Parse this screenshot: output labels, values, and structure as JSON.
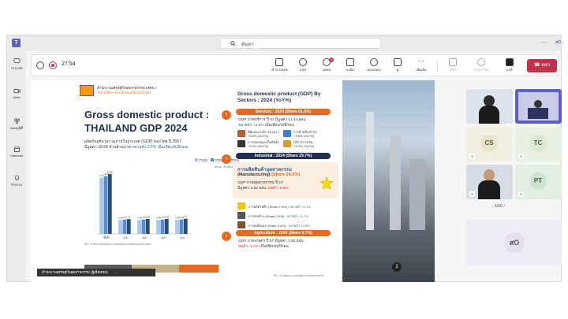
{
  "titlebar": {
    "search_placeholder": "ค้นหา",
    "more": "···",
    "user_initials": "สO"
  },
  "rail": [
    {
      "label": "การแชท",
      "icon": "chat-icon"
    },
    {
      "label": "Meet",
      "icon": "video-icon"
    },
    {
      "label": "คอมมูนิตี้",
      "icon": "community-icon"
    },
    {
      "label": "Calendar",
      "icon": "calendar-icon"
    },
    {
      "label": "กิจกรรม",
      "icon": "bell-icon"
    }
  ],
  "meeting": {
    "timer": "27:54",
    "controls": [
      {
        "label": "เข้าร่วมแชท",
        "icon": "chat-bubble-icon"
      },
      {
        "label": "แชท",
        "icon": "message-icon"
      },
      {
        "label": "บุคคล",
        "icon": "people-icon",
        "badge": "2"
      },
      {
        "label": "ยกมือ",
        "icon": "raise-hand-icon"
      },
      {
        "label": "ตอบสนอง",
        "icon": "reaction-icon"
      },
      {
        "label": "ดู",
        "icon": "view-icon"
      },
      {
        "label": "เพิ่มเติม",
        "icon": "more-icon"
      }
    ],
    "media_controls": [
      {
        "label": "กล้อง",
        "icon": "camera-off-icon"
      },
      {
        "label": "ไมโครโฟน",
        "icon": "mic-off-icon"
      },
      {
        "label": "แชร์",
        "icon": "share-icon"
      }
    ],
    "leave_label": "ออก"
  },
  "slide": {
    "org_th": "สำนักงานเศรษฐกิจอุตสาหกรรม (สศอ.)",
    "org_en": "The Office of Industrial Economics",
    "title_line1": "Gross domestic product :",
    "title_line2": "THAILAND GDP 2024",
    "subtitle_part1": "ผลิตภัณฑ์มวลรวมภายในประเทศ (GDP) ของไทย ปี 2567",
    "subtitle_part2": "มีมูลค่า 18.58 ล้านล้านบาท",
    "subtitle_part3": "ขยายตัว 2.5% เมื่อเทียบกับปีก่อน",
    "sector_title": "Gross domestic product (GDP) By Sectors : 2024 (YoY%)",
    "services_pill": "Services : 2024 (Share 61.6%)",
    "services_line1": "GDP ภาคบริการ ปี 67 มีมูลค่า 11.44 ลลบ.",
    "services_line2_a": "ขยายตัว +3.9%",
    "services_line2_b": "เมื่อเทียบกับปีก่อน",
    "svc_items": [
      {
        "label": "ที่พักแรม บริการอาหาร",
        "value": "+9.5% (YoY%)"
      },
      {
        "label": "การค้าปลีก/ค้าส่ง",
        "value": "+3.8% (YoY%)"
      },
      {
        "label": "การขนส่งและเก็บสินค้า",
        "value": "+9.0% (YoY%)"
      },
      {
        "label": "บริการการเงิน",
        "value": "+2.0% (YoY%)"
      }
    ],
    "industrial_pill": "Industrial : 2024 (Share 29.7%)",
    "mfg_title_th": "การผลิตสินค้าอุตสาหกรรม",
    "mfg_title_en": "(Manufacturing)",
    "mfg_share": "(Share 24.3%)",
    "mfg_line1": "GDP ภาคอุตสาหกรรม ปี 67",
    "mfg_line2_a": "มีมูลค่า 4.52 ลลบ.",
    "mfg_line2_b": "หดตัว -0.5%",
    "ind_items": [
      {
        "label": "การผลิตไฟฟ้า (Share 2.9%) :",
        "value": "ขยายตัว +0.1%"
      },
      {
        "label": "การก่อสร้าง (Share 2.0%) :",
        "value": "ขยายตัว +9.2%"
      },
      {
        "label": "การเหมืองแร่ (Share 0.4%) :",
        "value": "ขยายตัว +3.5%"
      }
    ],
    "agri_pill": "Agriculture : 2024 (Share 8.7%)",
    "agri_line1": "GDP ภาคเกษตร ปี 67 มีมูลค่า 1.62 ลลบ.",
    "agri_line2_a": "หดตัว -1.0%",
    "agri_line2_b": "เมื่อเทียบกับปีก่อน",
    "footer_src": "ที่มา : สภาพัฒนาการเศรษฐกิจและสังคมแห่งชาติ",
    "chart_src": "ที่มา : สำนักงานสภาพัฒนาการเศรษฐกิจและสังคมแห่งชาติ (สศช.)",
    "page_chip": "2",
    "share_tag": "สำนักงานเศรษฐกิจอุตสาหกรรม (ผู้เยี่ยมชม)"
  },
  "chart_data": {
    "type": "bar",
    "categories": [
      "ทั้งปี",
      "Q1",
      "Q2",
      "Q3",
      "Q4"
    ],
    "series": [
      {
        "name": "2565p",
        "values": [
          17.4,
          4.35,
          4.34,
          4.36,
          4.35
        ],
        "color": "#a9c6e8"
      },
      {
        "name": "2566p",
        "values": [
          17.9,
          4.47,
          4.47,
          4.47,
          4.49
        ],
        "color": "#5b8cc7"
      },
      {
        "name": "2567p",
        "values": [
          18.58,
          4.6,
          4.62,
          4.66,
          4.7
        ],
        "color": "#1f4e8c"
      }
    ],
    "unit": "หน่วย : ล้านล้านบาท",
    "ylim": [
      0,
      20
    ]
  },
  "participants": {
    "tiles": [
      {
        "name": "speaker-woman",
        "initials": "",
        "bg": "#dce3ec"
      },
      {
        "name": "speaker-man-podium",
        "initials": "",
        "bg": "#5b5fc7"
      },
      {
        "name": "participant-cs",
        "initials": "CS",
        "bg": "#f1efe1"
      },
      {
        "name": "participant-tc",
        "initials": "TC",
        "bg": "#e7f0e1"
      },
      {
        "name": "speaker-man-glasses",
        "initials": "",
        "bg": "#d6dde6"
      },
      {
        "name": "participant-pt",
        "initials": "PT",
        "bg": "#e3efe3"
      }
    ],
    "pager": "1/10",
    "self_initials": "สO"
  }
}
